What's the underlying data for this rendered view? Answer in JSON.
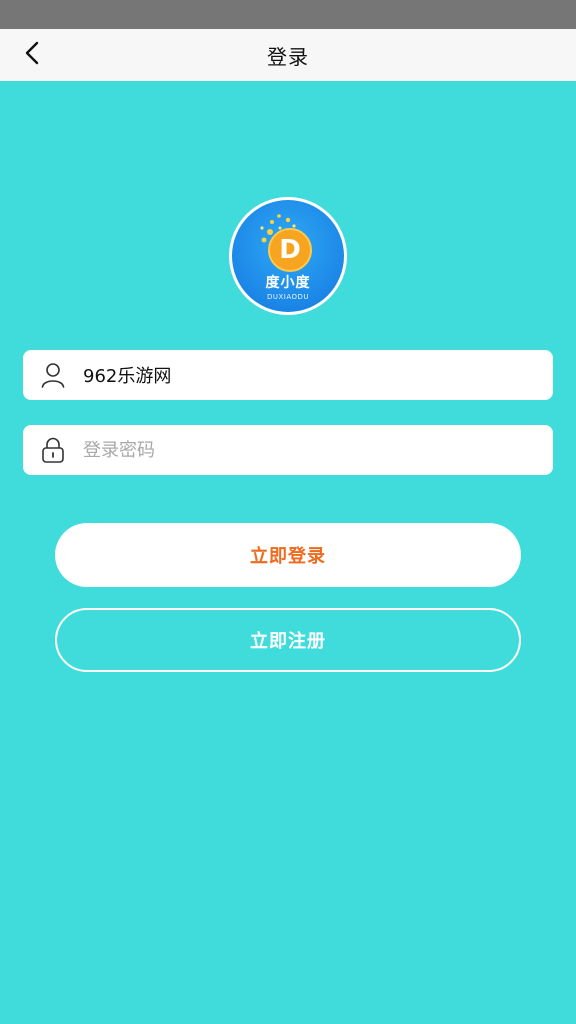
{
  "header": {
    "title": "登录",
    "back_icon": "chevron-left-icon"
  },
  "logo": {
    "letter": "D",
    "name": "度小度",
    "subtitle": "DUXIAODU",
    "colors": {
      "background": "#1b86e6",
      "badge": "#f7a520",
      "text": "#ffffff"
    }
  },
  "form": {
    "username": {
      "icon": "user-icon",
      "value": "962乐游网",
      "placeholder": ""
    },
    "password": {
      "icon": "lock-icon",
      "value": "",
      "placeholder": "登录密码"
    }
  },
  "buttons": {
    "login_label": "立即登录",
    "register_label": "立即注册"
  },
  "colors": {
    "page_background": "#40dcdc",
    "accent": "#f06a1e",
    "nav_background": "#f7f7f7",
    "status_bar": "#767676"
  }
}
